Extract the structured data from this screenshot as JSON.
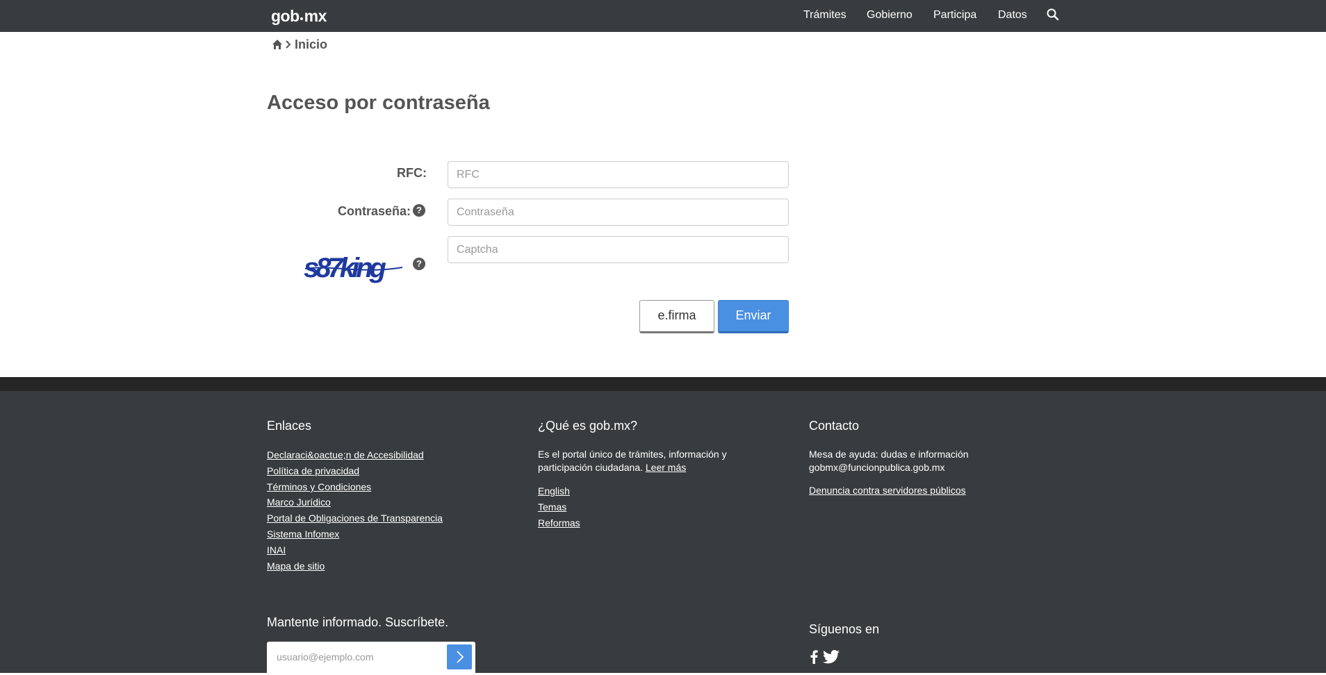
{
  "header": {
    "logo_text": "gob",
    "logo_suffix": "mx",
    "nav": [
      "Trámites",
      "Gobierno",
      "Participa",
      "Datos"
    ],
    "search_icon": "search-icon"
  },
  "breadcrumb": {
    "home_icon": "home-icon",
    "current": "Inicio"
  },
  "page": {
    "title": "Acceso por contraseña"
  },
  "form": {
    "rfc_label": "RFC:",
    "rfc_placeholder": "RFC",
    "password_label": "Contraseña:",
    "password_placeholder": "Contraseña",
    "captcha_text": "s87king",
    "captcha_placeholder": "Captcha",
    "help_icon": "question-circle-icon",
    "efirma_button": "e.firma",
    "submit_button": "Enviar"
  },
  "footer": {
    "links_heading": "Enlaces",
    "links": [
      "Declaraci&oactue;n de Accesibilidad",
      "Política de privacidad",
      "Términos y Condiciones",
      "Marco Jurídico",
      "Portal de Obligaciones de Transparencia",
      "Sistema Infomex",
      "INAI",
      "Mapa de sitio"
    ],
    "about_heading": "¿Qué es gob.mx?",
    "about_text": "Es el portal único de trámites, información y participación ciudadana.",
    "about_more": "Leer más",
    "about_links": [
      "English",
      "Temas",
      "Reformas"
    ],
    "contact_heading": "Contacto",
    "contact_line1": "Mesa de ayuda: dudas e información",
    "contact_line2": "gobmx@funcionpublica.gob.mx",
    "contact_link": "Denuncia contra servidores públicos",
    "subscribe_heading": "Mantente informado. Suscríbete.",
    "subscribe_placeholder": "usuario@ejemplo.com",
    "follow_heading": "Síguenos en",
    "social_icons": [
      "facebook-icon",
      "twitter-icon"
    ]
  },
  "colors": {
    "topbar": "#393c3e",
    "footer": "#393c3e",
    "footer_strip": "#252525",
    "primary_button": "#4a90e2",
    "captcha": "#1f3a9e"
  }
}
